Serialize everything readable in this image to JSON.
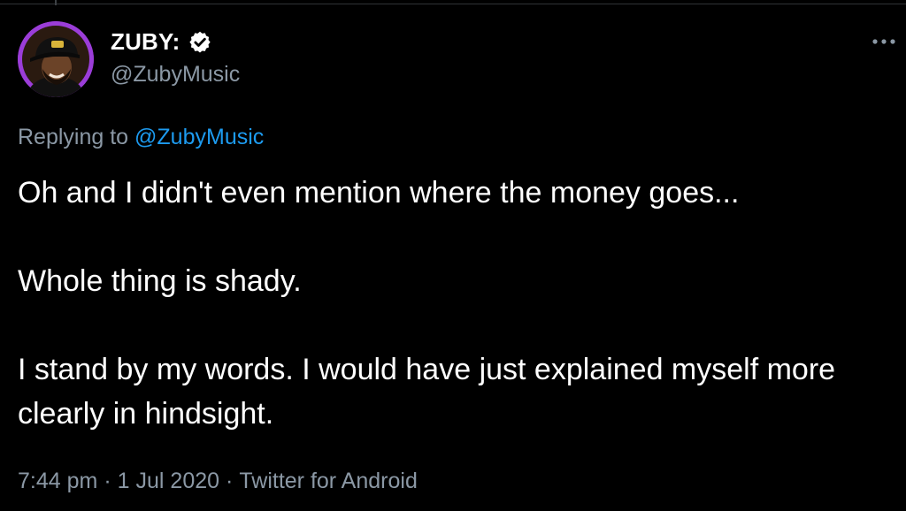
{
  "author": {
    "display_name": "ZUBY:",
    "handle": "@ZubyMusic",
    "verified": true,
    "avatar_ring_color": "#9b3dd8"
  },
  "reply_context": {
    "prefix": "Replying to",
    "mention": "@ZubyMusic"
  },
  "tweet": {
    "paragraphs": [
      "Oh and I didn't even mention where the money goes...",
      "Whole thing is shady.",
      "I stand by my words. I would have just explained myself more clearly in hindsight."
    ]
  },
  "meta": {
    "time": "7:44 pm",
    "date": "1 Jul 2020",
    "source": "Twitter for Android",
    "separator": "·"
  },
  "icons": {
    "more": "more-horizontal-icon",
    "verified": "verified-badge-icon"
  },
  "colors": {
    "background": "#000000",
    "text_primary": "#ffffff",
    "text_secondary": "#8b98a5",
    "link": "#1d9bf0"
  }
}
